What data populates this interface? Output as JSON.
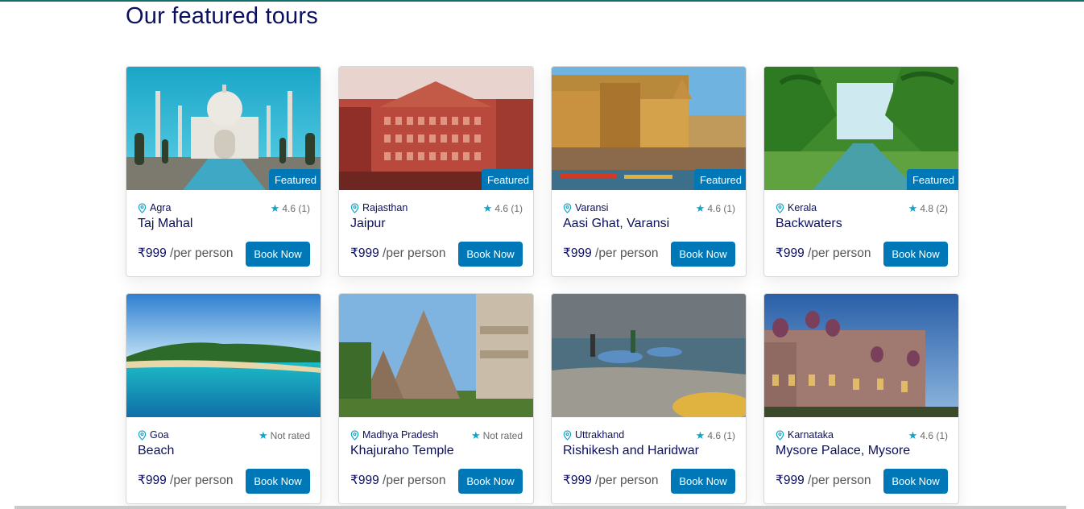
{
  "page": {
    "title": "Our featured tours"
  },
  "tours": [
    {
      "location": "Agra",
      "name": "Taj Mahal",
      "rating": "4.6 (1)",
      "featured": "Featured",
      "price": "₹999",
      "per": "/per person",
      "book": "Book Now"
    },
    {
      "location": "Rajasthan",
      "name": "Jaipur",
      "rating": "4.6 (1)",
      "featured": "Featured",
      "price": "₹999",
      "per": "/per person",
      "book": "Book Now"
    },
    {
      "location": "Varansi",
      "name": "Aasi Ghat, Varansi",
      "rating": "4.6 (1)",
      "featured": "Featured",
      "price": "₹999",
      "per": "/per person",
      "book": "Book Now"
    },
    {
      "location": "Kerala",
      "name": "Backwaters",
      "rating": "4.8 (2)",
      "featured": "Featured",
      "price": "₹999",
      "per": "/per person",
      "book": "Book Now"
    },
    {
      "location": "Goa",
      "name": "Beach",
      "rating": "Not rated",
      "featured": "",
      "price": "₹999",
      "per": "/per person",
      "book": "Book Now"
    },
    {
      "location": "Madhya Pradesh",
      "name": "Khajuraho Temple",
      "rating": "Not rated",
      "featured": "",
      "price": "₹999",
      "per": "/per person",
      "book": "Book Now"
    },
    {
      "location": "Uttrakhand",
      "name": "Rishikesh and Haridwar",
      "rating": "4.6 (1)",
      "featured": "",
      "price": "₹999",
      "per": "/per person",
      "book": "Book Now"
    },
    {
      "location": "Karnataka",
      "name": "Mysore Palace, Mysore",
      "rating": "4.6 (1)",
      "featured": "",
      "price": "₹999",
      "per": "/per person",
      "book": "Book Now"
    }
  ],
  "icons": {
    "location": "map-pin-icon",
    "rating": "star-icon"
  },
  "colors": {
    "accent": "#0077b6",
    "heading": "#0b0f5e",
    "star": "#0ea5c9"
  }
}
